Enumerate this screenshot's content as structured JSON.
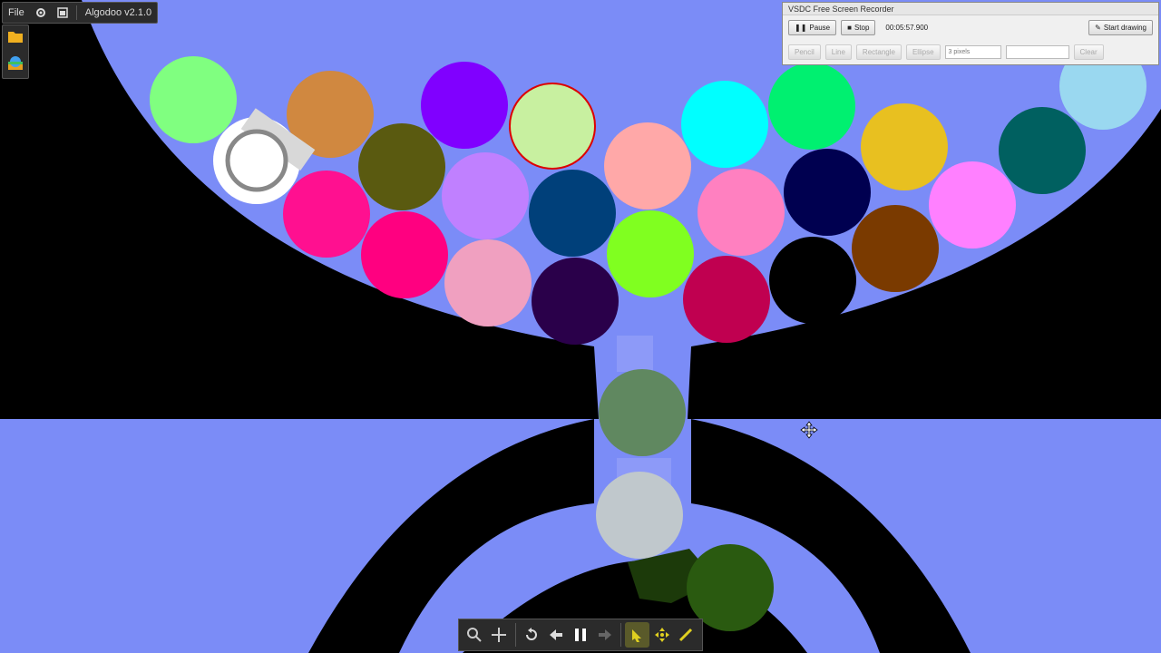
{
  "app": {
    "name": "Algodoo v2.1.0",
    "menu_file": "File",
    "icons": [
      "settings-gear-icon",
      "window-icon",
      "open-folder-icon",
      "scene-icon"
    ]
  },
  "toolbar": {
    "tools": [
      "zoom-icon",
      "pan-icon",
      "undo-icon",
      "step-back-icon",
      "pause-icon",
      "step-forward-icon",
      "drag-tool-icon",
      "move-tool-icon",
      "sketch-tool-icon"
    ]
  },
  "recorder": {
    "title": "VSDC Free Screen Recorder",
    "pause_label": "Pause",
    "stop_label": "Stop",
    "elapsed": "00:05:57.900",
    "start_label": "Start drawing",
    "pencil_label": "Pencil",
    "line_label": "Line",
    "rectangle_label": "Rectangle",
    "ellipse_label": "Ellipse",
    "thickness": "3 pixels",
    "clear_label": "Clear"
  },
  "colors": {
    "sky": "#7b8cf7",
    "track": "#000000",
    "accent_active_tool": "#e0d020"
  },
  "balls": [
    {
      "color": "#80ff80"
    },
    {
      "color": "#d08840"
    },
    {
      "color": "#8000ff"
    },
    {
      "color": "#00ffff"
    },
    {
      "color": "#00f070"
    },
    {
      "color": "#e8c020"
    },
    {
      "color": "#9ad8f0"
    },
    {
      "color": "#ffffff"
    },
    {
      "color": "#5a5a10"
    },
    {
      "color": "#c080ff"
    },
    {
      "color": "#ffa8a8"
    },
    {
      "color": "#000050"
    },
    {
      "color": "#006060"
    },
    {
      "color": "#ff1090"
    },
    {
      "color": "#00407a"
    },
    {
      "color": "#ff80c0"
    },
    {
      "color": "#ff80ff"
    },
    {
      "color": "#ff0080"
    },
    {
      "color": "#f0a0c0"
    },
    {
      "color": "#2a004a"
    },
    {
      "color": "#80ff20"
    },
    {
      "color": "#c00050"
    },
    {
      "color": "#000000"
    },
    {
      "color": "#7a3a00"
    },
    {
      "color": "#608860"
    },
    {
      "color": "#c0c8cc"
    },
    {
      "color": "#2a5a10"
    }
  ]
}
